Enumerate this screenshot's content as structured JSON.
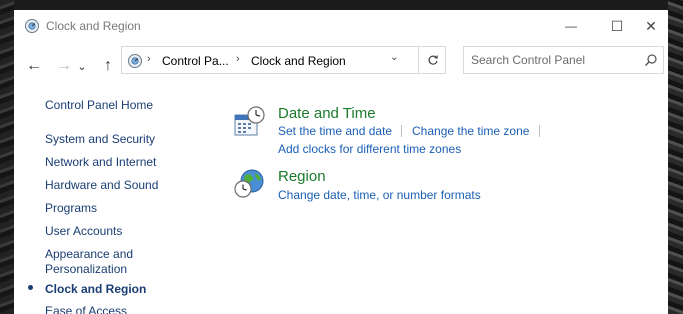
{
  "window": {
    "title": "Clock and Region",
    "min_glyph": "—",
    "max_glyph": "☐",
    "close_glyph": "✕"
  },
  "nav": {
    "back_glyph": "←",
    "forward_glyph": "→",
    "recent_glyph": "⌄",
    "up_glyph": "↑"
  },
  "address": {
    "crumbs": [
      "Control Pa...",
      "Clock and Region"
    ],
    "separator": "›",
    "dropdown_glyph": "⌄"
  },
  "search": {
    "placeholder": "Search Control Panel"
  },
  "sidebar": {
    "home": "Control Panel Home",
    "items": [
      {
        "label": "System and Security"
      },
      {
        "label": "Network and Internet"
      },
      {
        "label": "Hardware and Sound"
      },
      {
        "label": "Programs"
      },
      {
        "label": "User Accounts"
      },
      {
        "label": "Appearance and"
      },
      {
        "label": "Personalization"
      },
      {
        "label": "Clock and Region",
        "current": true
      },
      {
        "label": "Ease of Access"
      }
    ]
  },
  "categories": [
    {
      "title": "Date and Time",
      "icon": "calendar-clock-icon",
      "links": [
        "Set the time and date",
        "Change the time zone",
        "Add clocks for different time zones"
      ]
    },
    {
      "title": "Region",
      "icon": "globe-clock-icon",
      "links": [
        "Change date, time, or number formats"
      ]
    }
  ],
  "colors": {
    "category_title": "#1b7a2c",
    "link": "#1b5fb5",
    "sidebar_text": "#1a3e74"
  }
}
